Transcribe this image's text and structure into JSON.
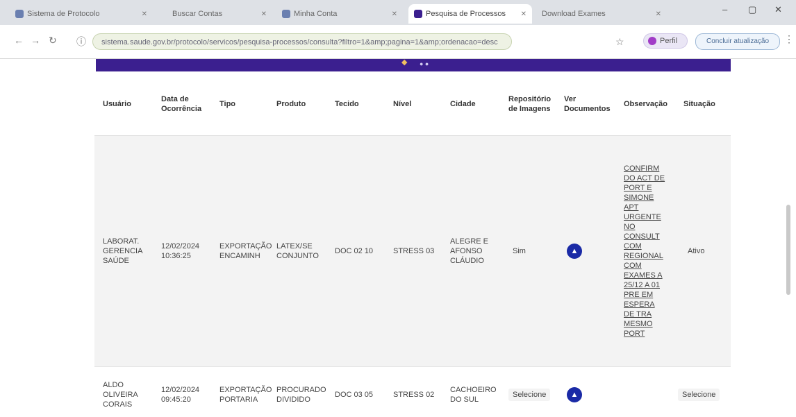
{
  "browser": {
    "tabs": [
      {
        "title": "Sistema de Protocolo",
        "active": false
      },
      {
        "title": "Buscar Contas",
        "active": false
      },
      {
        "title": "Minha Conta",
        "active": false
      },
      {
        "title": "Pesquisa de Processos",
        "active": true
      },
      {
        "title": "Download Exames",
        "active": false
      }
    ],
    "url": "sistema.saude.gov.br/protocolo/servicos/pesquisa-processos/consulta?filtro=1&amp;pagina=1&amp;ordenacao=desc",
    "profile_label": "Perfil",
    "finish_label": "Concluir atualização"
  },
  "table": {
    "headers": [
      "Usuário",
      "Data de Ocorrência",
      "Tipo",
      "Produto",
      "Tecido",
      "Nível",
      "Cidade",
      "Repositório de Imagens",
      "Ver Documentos",
      "Observação",
      "Situação"
    ],
    "rows": [
      {
        "user": "LABORAT. GERENCIA SAÚDE",
        "date": "12/02/2024 10:36:25",
        "type": "EXPORTAÇÃO ENCAMINH",
        "product": "LATEX/SE CONJUNTO",
        "tissue": "DOC 02 10",
        "level": "STRESS 03",
        "city": "ALEGRE E AFONSO CLÁUDIO",
        "repo": "Sim",
        "obs": "CONFIRM DO ACT DE PORT E SIMONE APT URGENTE NO CONSULT COM REGIONAL COM EXAMES A 25/12 A 01 PRE EM ESPERA DE TRA MESMO PORT",
        "status": "Ativo"
      },
      {
        "user": "ALDO OLIVEIRA CORAIS",
        "date": "12/02/2024 09:45:20",
        "type": "EXPORTAÇÃO PORTARIA",
        "product": "PROCURADO DIVIDIDO",
        "tissue": "DOC 03 05",
        "level": "STRESS 02",
        "city": "CACHOEIRO DO SUL",
        "repo": "Selecione",
        "obs": "",
        "status": "Selecione"
      }
    ]
  },
  "icons": {
    "doc_badge_glyph": "▲"
  }
}
